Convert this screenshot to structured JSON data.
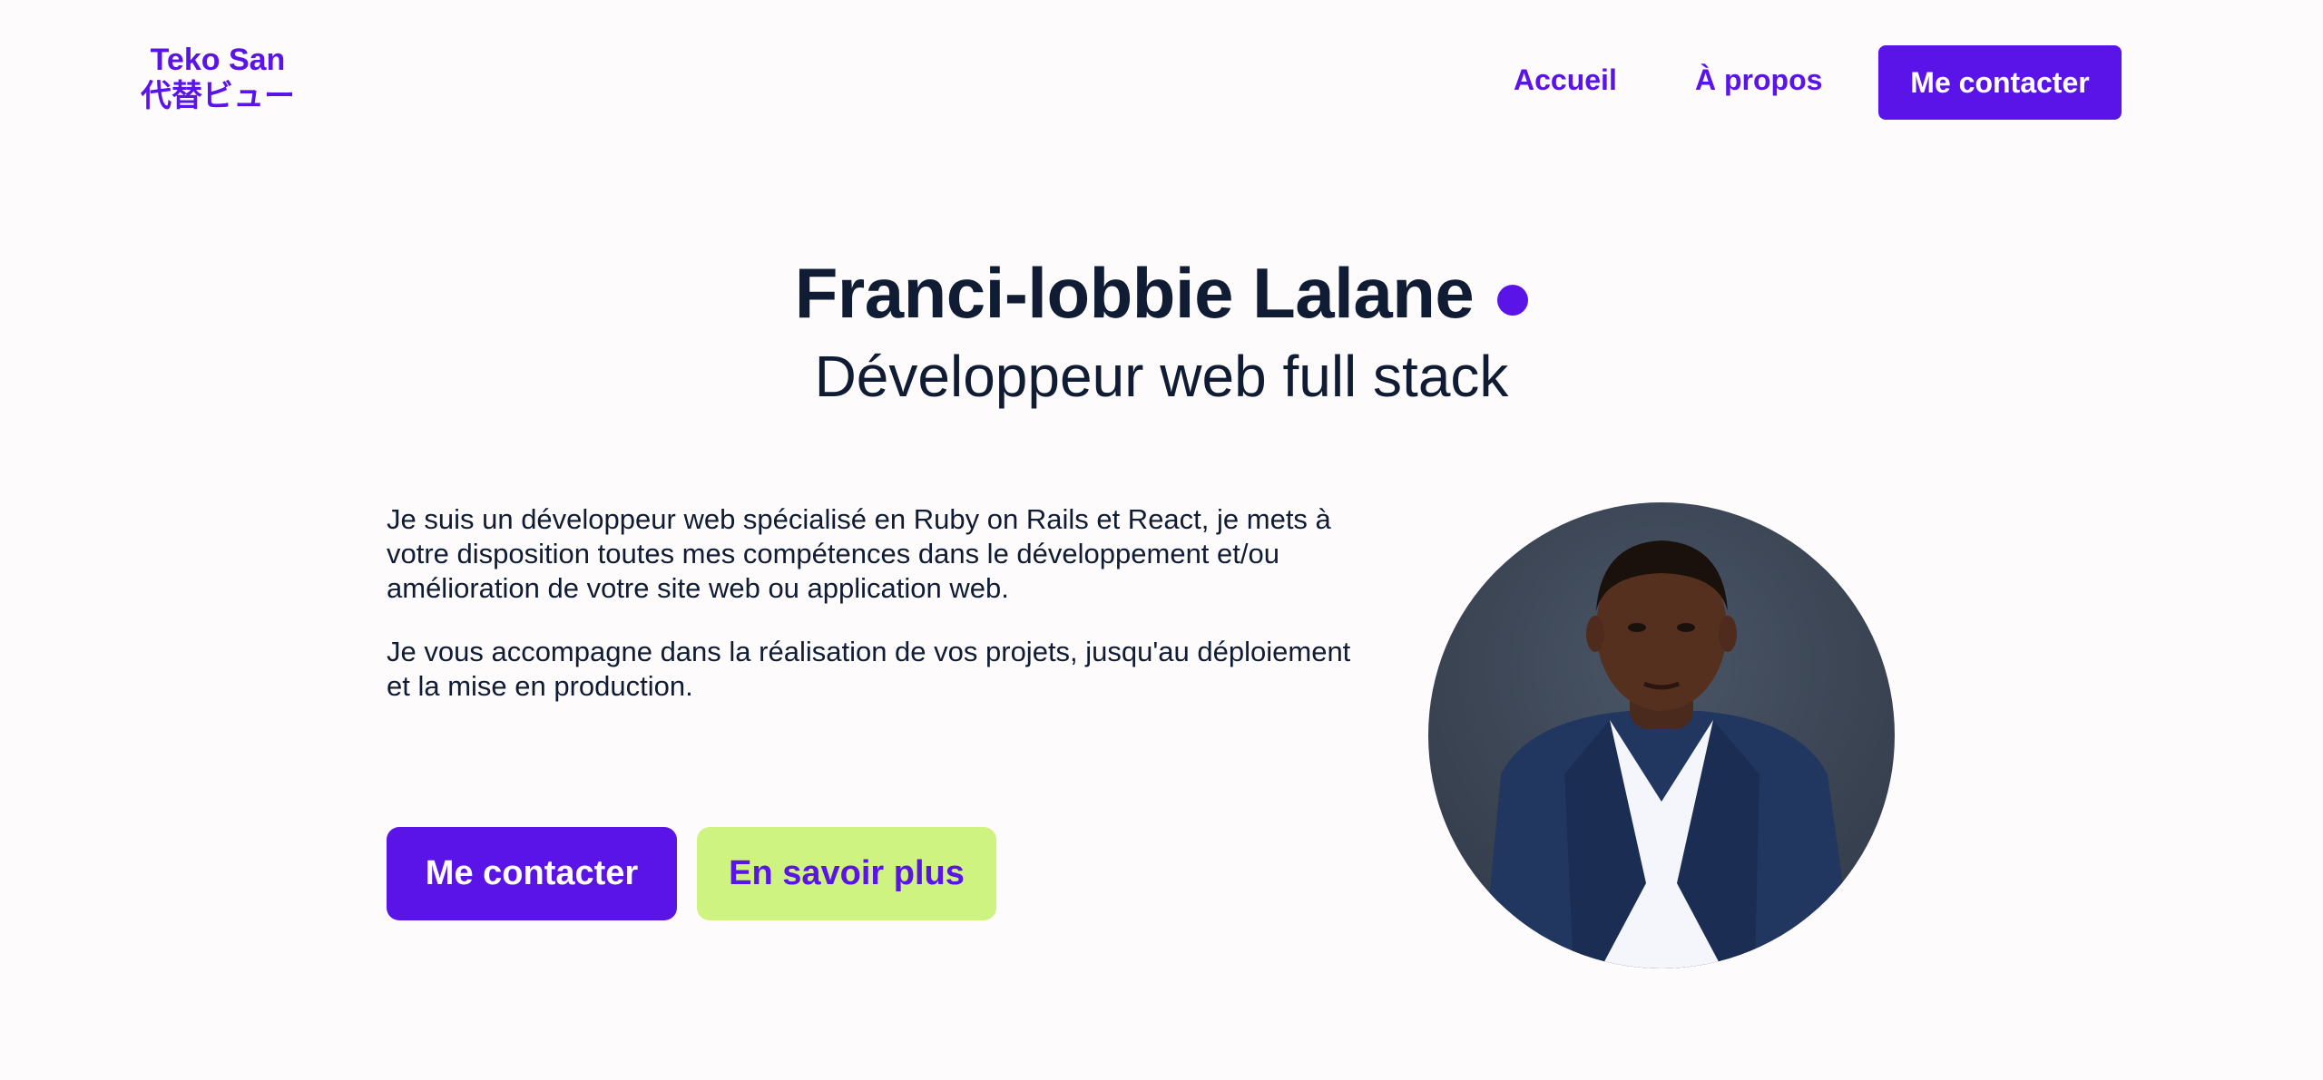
{
  "header": {
    "logo_line1": "Teko San",
    "logo_line2": "代替ビュー",
    "nav": {
      "home": "Accueil",
      "about": "À propos",
      "contact": "Me contacter"
    }
  },
  "hero": {
    "name": "Franci-lobbie Lalane",
    "role": "Développeur web full stack",
    "intro_paragraphs": [
      "Je suis un développeur web spécialisé en Ruby on Rails et React, je mets à votre disposition toutes mes compétences dans le développement et/ou amélioration de votre site web ou application web.",
      "Je vous accompagne dans la réalisation de vos projets, jusqu'au déploiement et la mise en production."
    ],
    "primary_button": "Me contacter",
    "secondary_button": "En savoir plus"
  },
  "colors": {
    "accent": "#5b14e8",
    "lime": "#cff381",
    "text": "#0f1c33",
    "background": "#fdfbfb"
  }
}
